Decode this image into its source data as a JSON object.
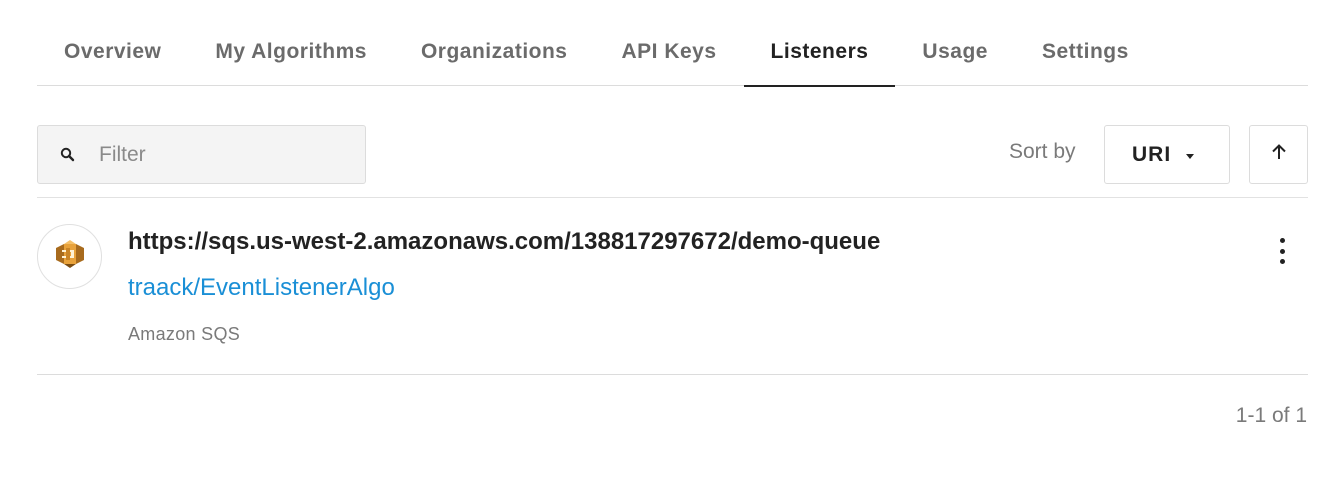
{
  "tabs": [
    {
      "label": "Overview",
      "active": false
    },
    {
      "label": "My Algorithms",
      "active": false
    },
    {
      "label": "Organizations",
      "active": false
    },
    {
      "label": "API Keys",
      "active": false
    },
    {
      "label": "Listeners",
      "active": true
    },
    {
      "label": "Usage",
      "active": false
    },
    {
      "label": "Settings",
      "active": false
    }
  ],
  "filter": {
    "placeholder": "Filter",
    "value": ""
  },
  "sort": {
    "label": "Sort by",
    "selected": "URI",
    "direction": "ascending"
  },
  "listeners": [
    {
      "uri": "https://sqs.us-west-2.amazonaws.com/138817297672/demo-queue",
      "algorithm": "traack/EventListenerAlgo",
      "type": "Amazon SQS",
      "icon": "amazon-sqs-icon"
    }
  ],
  "pagination": {
    "text": "1-1 of 1"
  },
  "colors": {
    "link": "#1a8fd6",
    "sqs_orange": "#e8a23b",
    "sqs_dark": "#a86b1d"
  }
}
